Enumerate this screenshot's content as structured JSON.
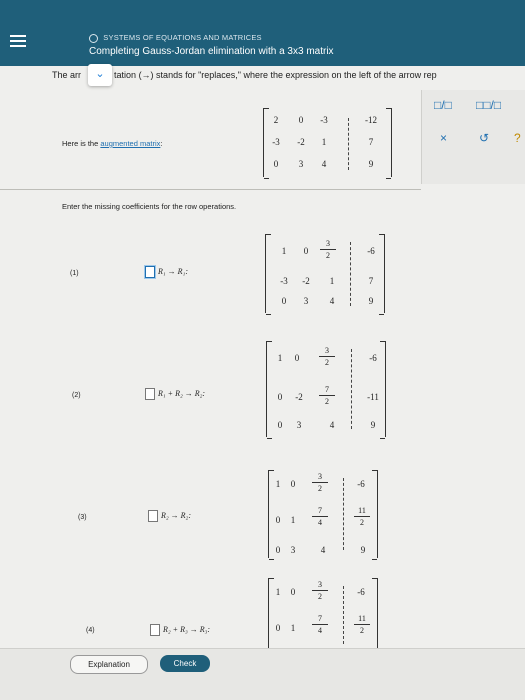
{
  "header": {
    "topic": "SYSTEMS OF EQUATIONS AND MATRICES",
    "title": "Completing Gauss-Jordan elimination with a 3x3 matrix"
  },
  "instruction": {
    "before": "The arr",
    "after": "tation (→) stands for \"replaces,\" where the expression on the left of the arrow rep"
  },
  "tools": {
    "fraction": "□/□",
    "mixed": "□□/□",
    "clear": "×",
    "undo": "↺",
    "help": "?"
  },
  "augmented_label": {
    "text": "Here is the ",
    "link": "augmented matrix",
    "suffix": ":"
  },
  "prompt": "Enter the missing coefficients for the row operations.",
  "steps": [
    {
      "num": "(1)",
      "op": "R₁ → R₁:"
    },
    {
      "num": "(2)",
      "op": "R₁ + R₂ → R₂:"
    },
    {
      "num": "(3)",
      "op": "R₂ → R₂:"
    },
    {
      "num": "(4)",
      "op": "R₂ + R₃ → R₃:"
    }
  ],
  "matrices": {
    "start": [
      [
        "2",
        "0",
        "-3",
        "-12"
      ],
      [
        "-3",
        "-2",
        "1",
        "7"
      ],
      [
        "0",
        "3",
        "4",
        "9"
      ]
    ],
    "m1": {
      "r1": [
        "1",
        "0"
      ],
      "r1_frac": [
        "3",
        "2"
      ],
      "r1_last": "-6",
      "r2": [
        "-3",
        "-2",
        "1",
        "7"
      ],
      "r3": [
        "0",
        "3",
        "4",
        "9"
      ]
    },
    "m2": {
      "r1": [
        "1",
        "0"
      ],
      "r1_frac": [
        "3",
        "2"
      ],
      "r1_last": "-6",
      "r2": [
        "0",
        "-2"
      ],
      "r2_frac": [
        "7",
        "2"
      ],
      "r2_last": "-11",
      "r3": [
        "0",
        "3",
        "4",
        "9"
      ]
    },
    "m3": {
      "r1": [
        "1",
        "0"
      ],
      "r1_frac": [
        "3",
        "2"
      ],
      "r1_last": "-6",
      "r2": [
        "0",
        "1"
      ],
      "r2_frac": [
        "7",
        "4"
      ],
      "r2_last_frac": [
        "11",
        "2"
      ],
      "r3": [
        "0",
        "3",
        "4",
        "9"
      ]
    },
    "m4": {
      "r1": [
        "1",
        "0"
      ],
      "r1_frac": [
        "3",
        "2"
      ],
      "r1_last": "-6",
      "r2": [
        "0",
        "1"
      ],
      "r2_frac": [
        "7",
        "4"
      ],
      "r2_last_frac": [
        "11",
        "2"
      ]
    }
  },
  "footer": {
    "explanation": "Explanation",
    "check": "Check"
  }
}
